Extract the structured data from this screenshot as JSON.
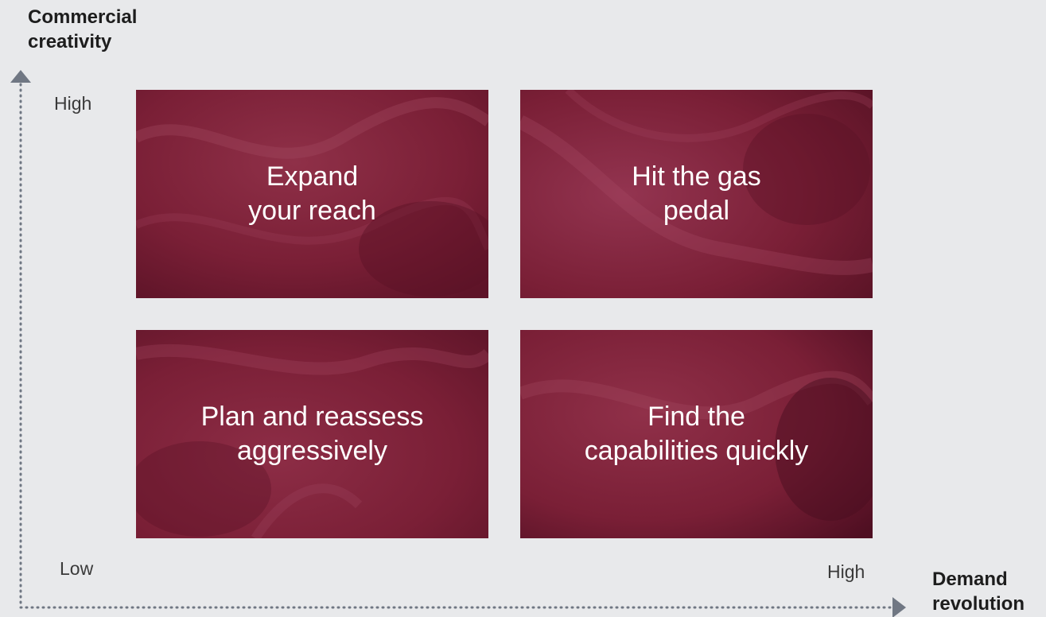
{
  "y_axis": {
    "title": "Commercial\ncreativity",
    "high_label": "High"
  },
  "x_axis": {
    "title": "Demand\nrevolution",
    "low_label": "Low",
    "high_label": "High"
  },
  "quadrants": {
    "top_left": "Expand\nyour reach",
    "top_right": "Hit the gas\npedal",
    "bottom_left": "Plan and reassess\naggressively",
    "bottom_right": "Find the\ncapabilities quickly"
  },
  "colors": {
    "background": "#e8e9eb",
    "quadrant_fill": "#7a1f36",
    "axis": "#707783",
    "title_text": "#1d1d1d",
    "quadrant_text": "#ffffff"
  }
}
